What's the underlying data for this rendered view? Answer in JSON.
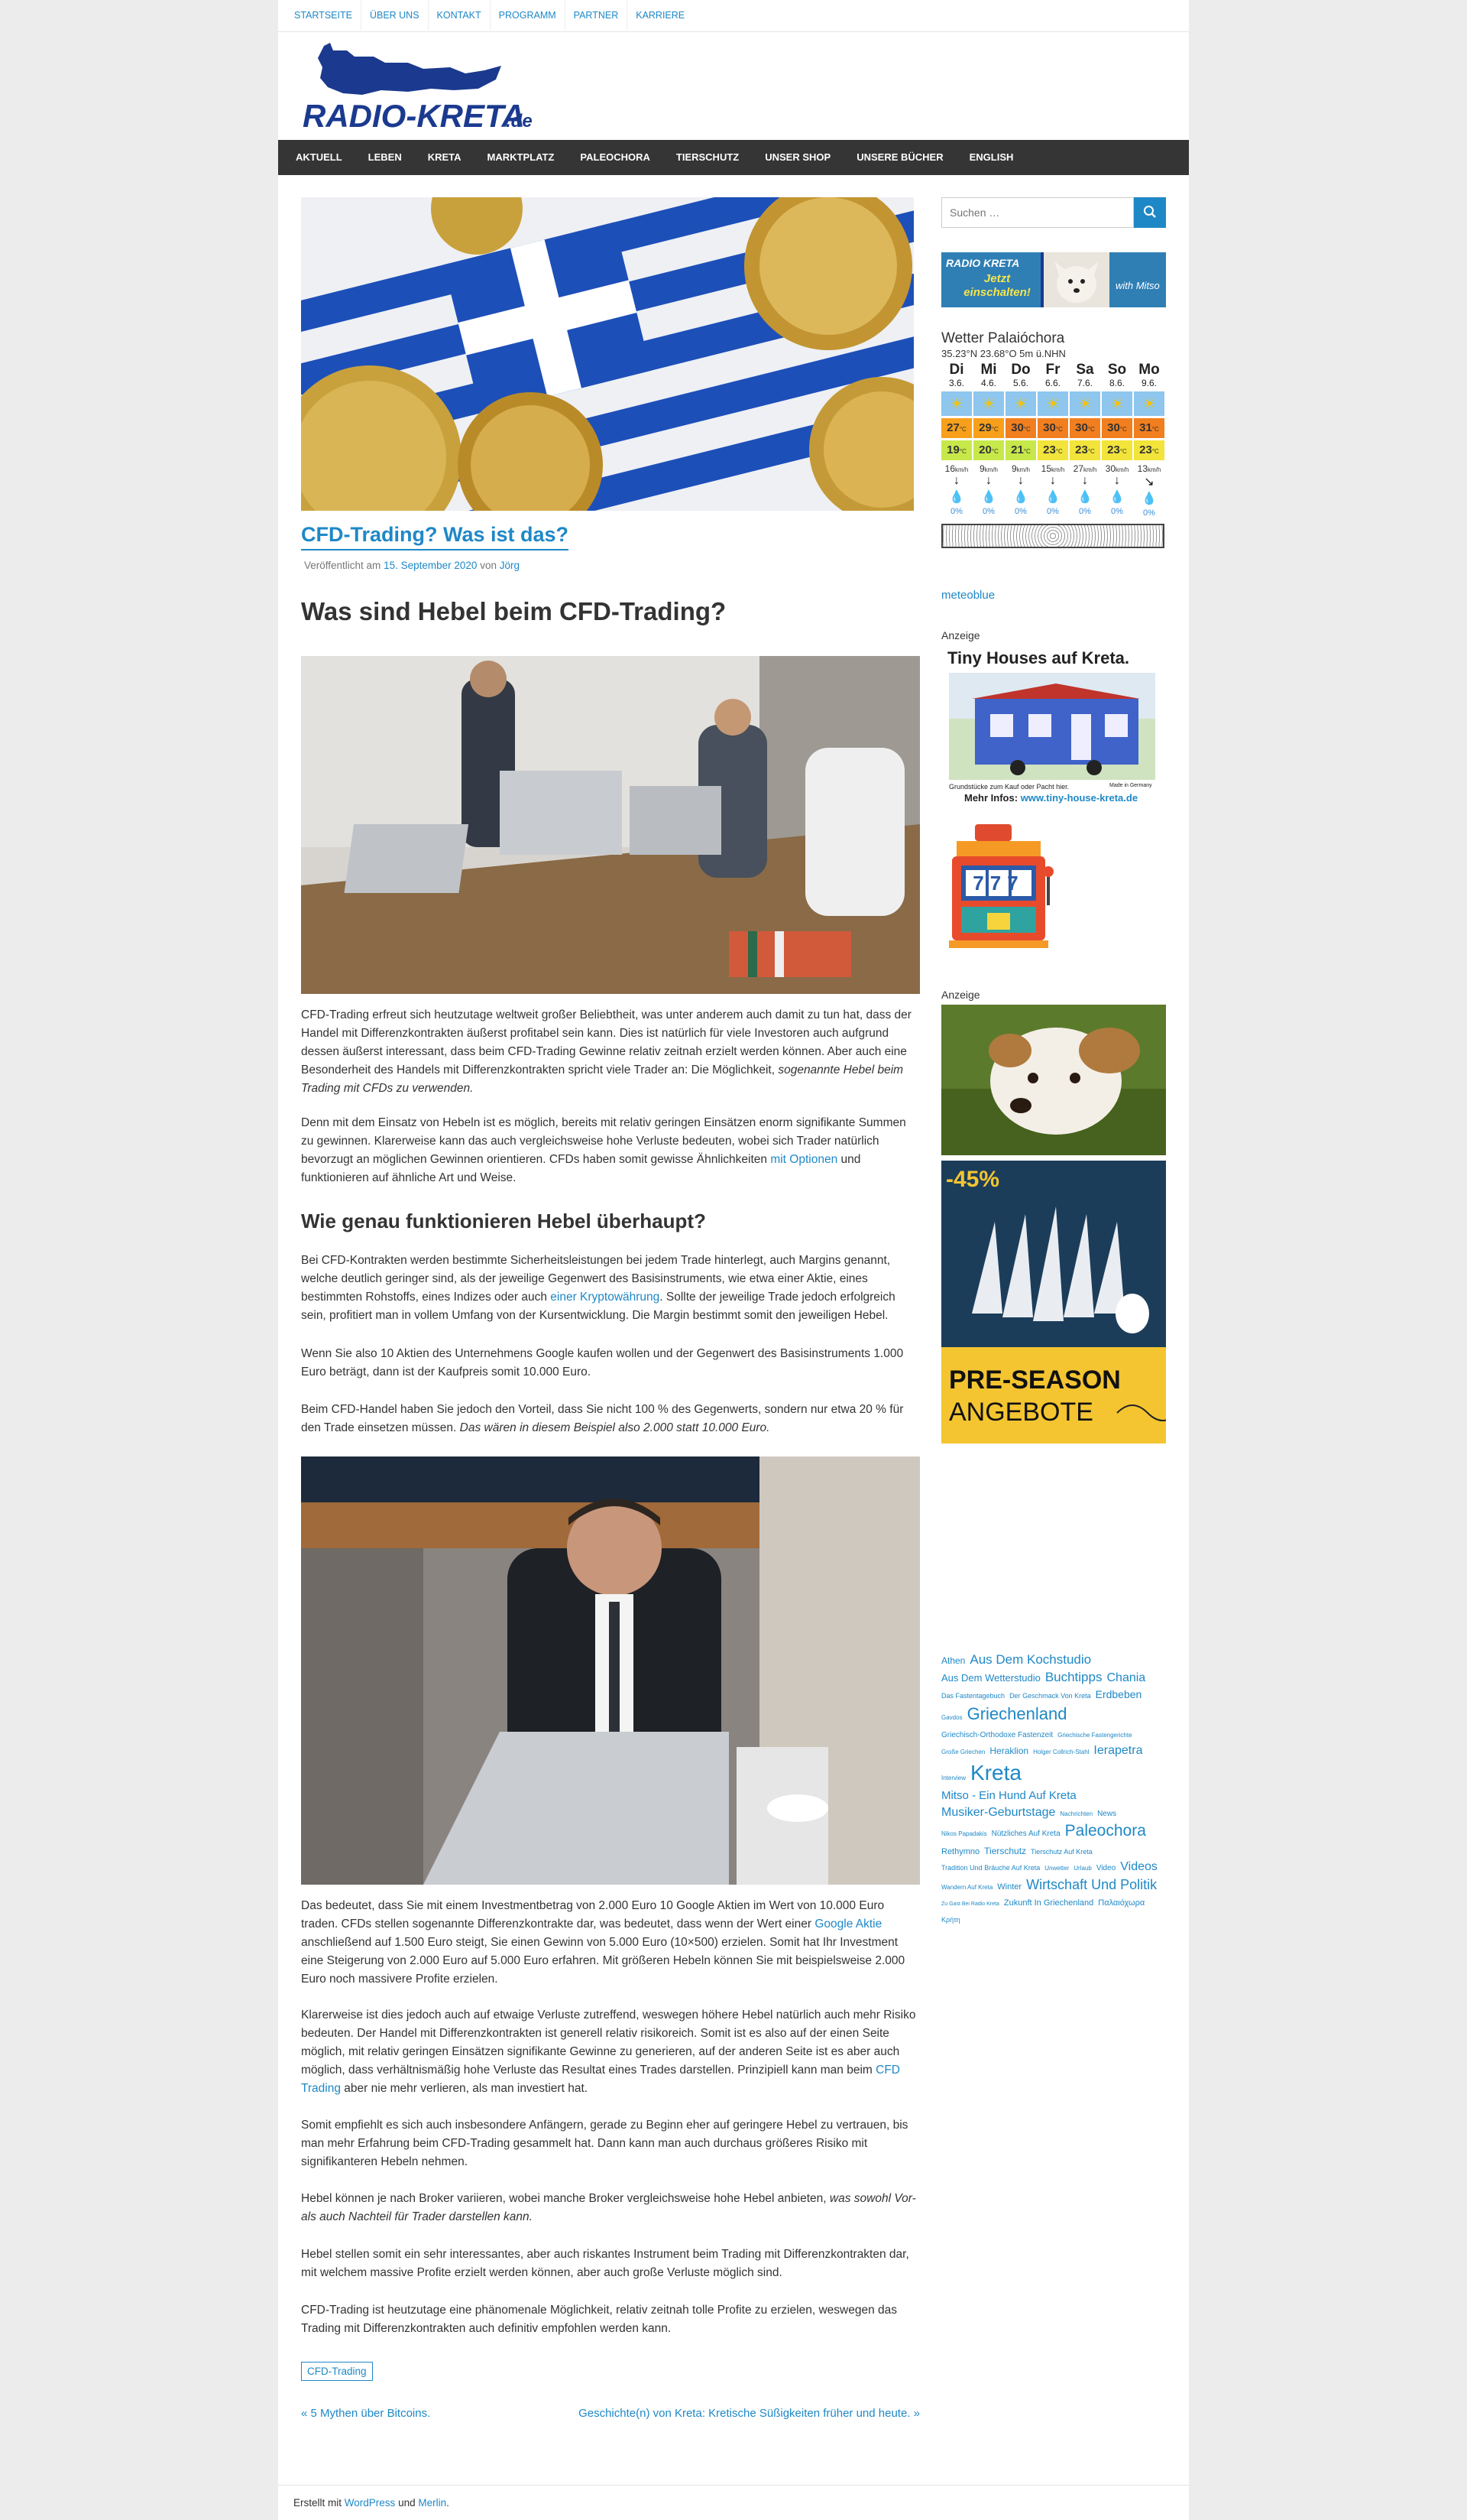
{
  "top_nav": [
    "STARTSEITE",
    "ÜBER UNS",
    "KONTAKT",
    "PROGRAMM",
    "PARTNER",
    "KARRIERE"
  ],
  "logo_text": "RADIO-KRETA.de",
  "main_nav": [
    "AKTUELL",
    "LEBEN",
    "KRETA",
    "MARKTPLATZ",
    "PALEOCHORA",
    "TIERSCHUTZ",
    "UNSER SHOP",
    "UNSERE BÜCHER",
    "ENGLISH"
  ],
  "post": {
    "title": "CFD-Trading? Was ist das?",
    "meta_prefix": "Veröffentlicht am",
    "meta_date": "15. September 2020",
    "meta_by": "von",
    "meta_author": "Jörg",
    "h1": "Was sind Hebel beim CFD-Trading?",
    "p1": "CFD-Trading erfreut sich heutzutage weltweit großer Beliebtheit, was unter anderem auch damit zu tun hat, dass der Handel mit Differenzkontrakten äußerst profitabel sein kann. Dies ist natürlich für viele Investoren auch aufgrund dessen äußerst interessant, dass beim CFD-Trading Gewinne relativ zeitnah erzielt werden können. Aber auch eine Besonderheit des Handels mit Differenzkontrakten spricht viele Trader an: Die Möglichkeit,",
    "p1_em": "sogenannte Hebel beim Trading mit CFDs zu verwenden.",
    "p2a": "Denn mit dem Einsatz von Hebeln ist es möglich, bereits mit relativ geringen Einsätzen enorm signifikante Summen zu gewinnen. Klarerweise kann das auch vergleichsweise hohe Verluste bedeuten, wobei sich Trader natürlich bevorzugt an möglichen Gewinnen orientieren. CFDs haben somit gewisse Ähnlichkeiten",
    "p2_link": "mit Optionen",
    "p2b": "und funktionieren auf ähnliche Art und Weise.",
    "h2": "Wie genau funktionieren Hebel überhaupt?",
    "p3a": "Bei CFD-Kontrakten werden bestimmte Sicherheitsleistungen bei jedem Trade hinterlegt, auch Margins genannt, welche deutlich geringer sind, als der jeweilige Gegenwert des Basisinstruments, wie etwa einer Aktie, eines bestimmten Rohstoffs, eines Indizes oder auch",
    "p3_link": "einer Kryptowährung",
    "p3b": ". Sollte der jeweilige Trade jedoch erfolgreich sein, profitiert man in vollem Umfang von der Kursentwicklung. Die Margin bestimmt somit den jeweiligen Hebel.",
    "p4": "Wenn Sie also 10 Aktien des Unternehmens Google kaufen wollen und der Gegenwert des Basisinstruments 1.000 Euro beträgt, dann ist der Kaufpreis somit 10.000 Euro.",
    "p5": "Beim CFD-Handel haben Sie jedoch den Vorteil, dass Sie nicht 100 % des Gegenwerts, sondern nur etwa 20 % für den Trade einsetzen müssen.",
    "p5_em": "Das wären in diesem Beispiel also 2.000 statt 10.000 Euro.",
    "p6a": "Das bedeutet, dass Sie mit einem Investmentbetrag von 2.000 Euro 10 Google Aktien im Wert von 10.000 Euro traden. CFDs stellen sogenannte Differenzkontrakte dar, was bedeutet, dass wenn der Wert einer",
    "p6_link": "Google Aktie",
    "p6b": "anschließend auf 1.500 Euro steigt, Sie einen Gewinn von 5.000 Euro (10×500) erzielen. Somit hat Ihr Investment eine Steigerung von 2.000 Euro auf 5.000 Euro erfahren. Mit größeren Hebeln können Sie mit beispielsweise 2.000 Euro noch massivere Profite erzielen.",
    "p7a": "Klarerweise ist dies jedoch auch auf etwaige Verluste zutreffend, weswegen höhere Hebel natürlich auch mehr Risiko bedeuten. Der Handel mit Differenzkontrakten ist generell relativ risikoreich. Somit ist es also auf der einen Seite möglich, mit relativ geringen Einsätzen signifikante Gewinne zu generieren, auf der anderen Seite ist es aber auch möglich, dass verhältnismäßig hohe Verluste das Resultat eines Trades darstellen. Prinzipiell kann man beim",
    "p7_link": "CFD Trading",
    "p7b": "aber nie mehr verlieren, als man investiert hat.",
    "p8": "Somit empfiehlt es sich auch insbesondere Anfängern, gerade zu Beginn eher auf geringere Hebel zu vertrauen, bis man mehr Erfahrung beim CFD-Trading gesammelt hat. Dann kann man auch durchaus größeres Risiko mit signifikanteren Hebeln nehmen.",
    "p9": "Hebel können je nach Broker variieren, wobei manche Broker vergleichsweise hohe Hebel anbieten,",
    "p9_em": "was sowohl Vor- als auch Nachteil für Trader darstellen kann.",
    "p10": "Hebel stellen somit ein sehr interessantes, aber auch riskantes Instrument beim Trading mit Differenzkontrakten dar, mit welchem massive Profite erzielt werden können, aber auch große Verluste möglich sind.",
    "p11": "CFD-Trading ist heutzutage eine phänomenale Möglichkeit, relativ zeitnah tolle Profite zu erzielen, weswegen das Trading mit Differenzkontrakten auch definitiv empfohlen werden kann.",
    "tag": "CFD-Trading",
    "prev": "« 5 Mythen über Bitcoins.",
    "next": "Geschichte(n) von Kreta: Kretische Süßigkeiten früher und heute. »"
  },
  "sidebar": {
    "search_placeholder": "Suchen …",
    "radio_banner_line1": "RADIO KRETA",
    "radio_banner_line2": "Jetzt einschalten!",
    "weather": {
      "title": "Wetter Palaióchora",
      "sub": "35.23°N 23.68°O 5m ü.NHN",
      "days": [
        {
          "d": "Di",
          "date": "3.6.",
          "max": "27",
          "min": "19",
          "wind": "16",
          "pct": "0%"
        },
        {
          "d": "Mi",
          "date": "4.6.",
          "max": "29",
          "min": "20",
          "wind": "9",
          "pct": "0%"
        },
        {
          "d": "Do",
          "date": "5.6.",
          "max": "30",
          "min": "21",
          "wind": "9",
          "pct": "0%"
        },
        {
          "d": "Fr",
          "date": "6.6.",
          "max": "30",
          "min": "23",
          "wind": "15",
          "pct": "0%"
        },
        {
          "d": "Sa",
          "date": "7.6.",
          "max": "30",
          "min": "23",
          "wind": "27",
          "pct": "0%"
        },
        {
          "d": "So",
          "date": "8.6.",
          "max": "30",
          "min": "23",
          "wind": "30",
          "pct": "0%"
        },
        {
          "d": "Mo",
          "date": "9.6.",
          "max": "31",
          "min": "23",
          "wind": "13",
          "pct": "0%"
        }
      ],
      "unit_c": "°C",
      "unit_kmh": "km/h",
      "link": "meteoblue"
    },
    "ad_label": "Anzeige",
    "tiny_house_title": "Tiny Houses auf Kreta.",
    "tiny_house_sub": "Grundstücke zum Kauf oder Pacht hier.",
    "tiny_house_made": "Made in Germany",
    "tiny_house_info": "Mehr Infos:",
    "tiny_house_url": "www.tiny-house-kreta.de",
    "slot_text": "777",
    "ad_label2": "Anzeige",
    "sale_pct": "-45%",
    "sale_line1": "PRE-SEASON",
    "sale_line2": "ANGEBOTE",
    "tags": [
      {
        "t": "Athen",
        "s": 12
      },
      {
        "t": "Aus Dem Kochstudio",
        "s": 17
      },
      {
        "t": "Aus Dem Wetterstudio",
        "s": 13
      },
      {
        "t": "Buchtipps",
        "s": 17
      },
      {
        "t": "Chania",
        "s": 16
      },
      {
        "t": "Das Fastentagebuch",
        "s": 9
      },
      {
        "t": "Der Geschmack Von Kreta",
        "s": 9
      },
      {
        "t": "Erdbeben",
        "s": 14
      },
      {
        "t": "Gavdos",
        "s": 8
      },
      {
        "t": "Griechenland",
        "s": 22
      },
      {
        "t": "Griechisch-Orthodoxe Fastenzeit",
        "s": 10
      },
      {
        "t": "Griechische Fastengerichte",
        "s": 8
      },
      {
        "t": "Große Griechen",
        "s": 8
      },
      {
        "t": "Heraklion",
        "s": 12
      },
      {
        "t": "Holger Collrich-Stahl",
        "s": 8
      },
      {
        "t": "Ierapetra",
        "s": 16
      },
      {
        "t": "Interview",
        "s": 8
      },
      {
        "t": "Kreta",
        "s": 28
      },
      {
        "t": "Mitso - Ein Hund Auf Kreta",
        "s": 15
      },
      {
        "t": "Musiker-Geburtstage",
        "s": 16
      },
      {
        "t": "Nachrichten",
        "s": 8
      },
      {
        "t": "News",
        "s": 10
      },
      {
        "t": "Nikos Papadakis",
        "s": 8
      },
      {
        "t": "Nützliches Auf Kreta",
        "s": 10
      },
      {
        "t": "Paleochora",
        "s": 21
      },
      {
        "t": "Rethymno",
        "s": 11
      },
      {
        "t": "Tierschutz",
        "s": 12
      },
      {
        "t": "Tierschutz Auf Kreta",
        "s": 9
      },
      {
        "t": "Tradition Und Bräuche Auf Kreta",
        "s": 9
      },
      {
        "t": "Unwetter",
        "s": 8
      },
      {
        "t": "Urlaub",
        "s": 8
      },
      {
        "t": "Video",
        "s": 10
      },
      {
        "t": "Videos",
        "s": 16
      },
      {
        "t": "Wandern Auf Kreta",
        "s": 8
      },
      {
        "t": "Winter",
        "s": 11
      },
      {
        "t": "Wirtschaft Und Politik",
        "s": 18
      },
      {
        "t": "Zu Gast Bei Radio Kreta",
        "s": 7
      },
      {
        "t": "Zukunft In Griechenland",
        "s": 11
      },
      {
        "t": "Παλαιόχωρα",
        "s": 11
      },
      {
        "t": "Κρήτη",
        "s": 9
      }
    ]
  },
  "footer": {
    "prefix": "Erstellt mit",
    "wp": "WordPress",
    "and": "und",
    "merlin": "Merlin",
    "dot": "."
  },
  "colors": {
    "link": "#1e88c7",
    "nav_bg": "#353535",
    "logo_blue": "#1b3a8f",
    "max_hot": "#f17e1f",
    "max_warm": "#f8a01b",
    "min_lime": "#c7e84a",
    "min_yellow": "#f2e43a"
  }
}
